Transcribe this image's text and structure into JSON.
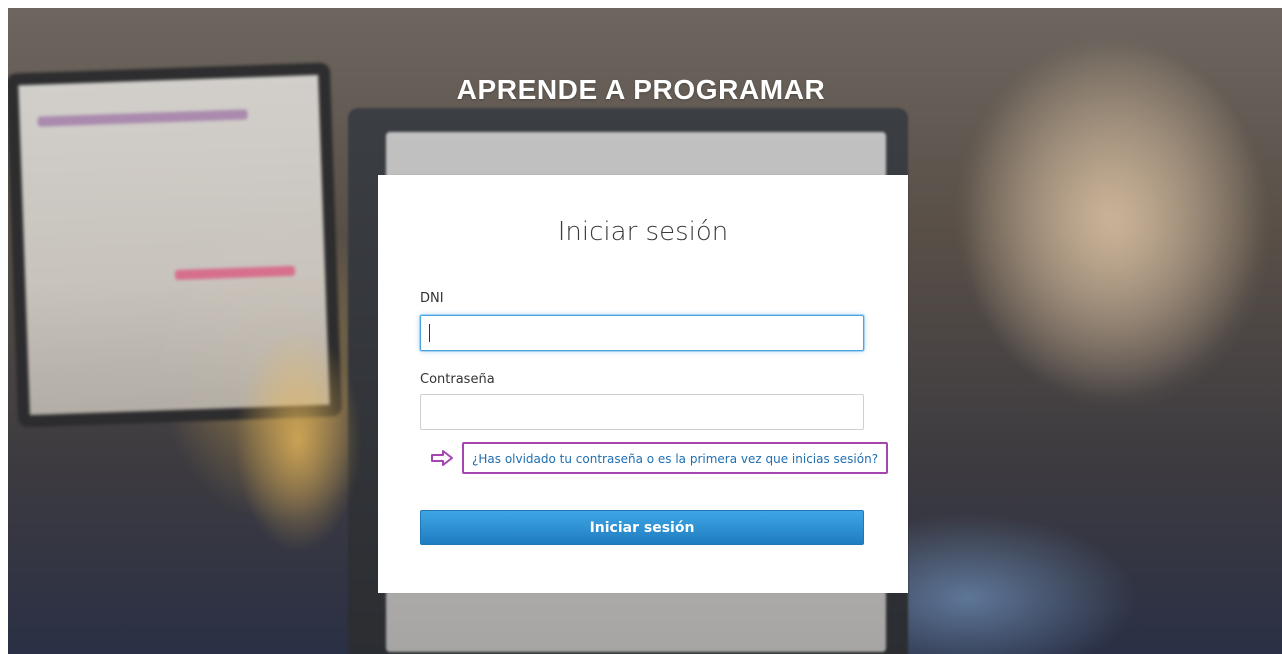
{
  "header": {
    "brand_title": "APRENDE A PROGRAMAR"
  },
  "login": {
    "title": "Iniciar sesión",
    "fields": {
      "dni": {
        "label": "DNI",
        "value": "",
        "placeholder": ""
      },
      "password": {
        "label": "Contraseña",
        "value": "",
        "placeholder": ""
      }
    },
    "forgot": {
      "arrow_icon": "arrow-right-icon",
      "text": "¿Has olvidado tu contraseña o es la primera vez que inicias sesión?"
    },
    "submit_label": "Iniciar sesión"
  },
  "colors": {
    "link": "#1f6fb2",
    "highlight_box": "#a445b2",
    "primary_button_top": "#3ea6e5",
    "primary_button_bottom": "#1f7cc0",
    "focus_ring": "#4aa3df"
  }
}
